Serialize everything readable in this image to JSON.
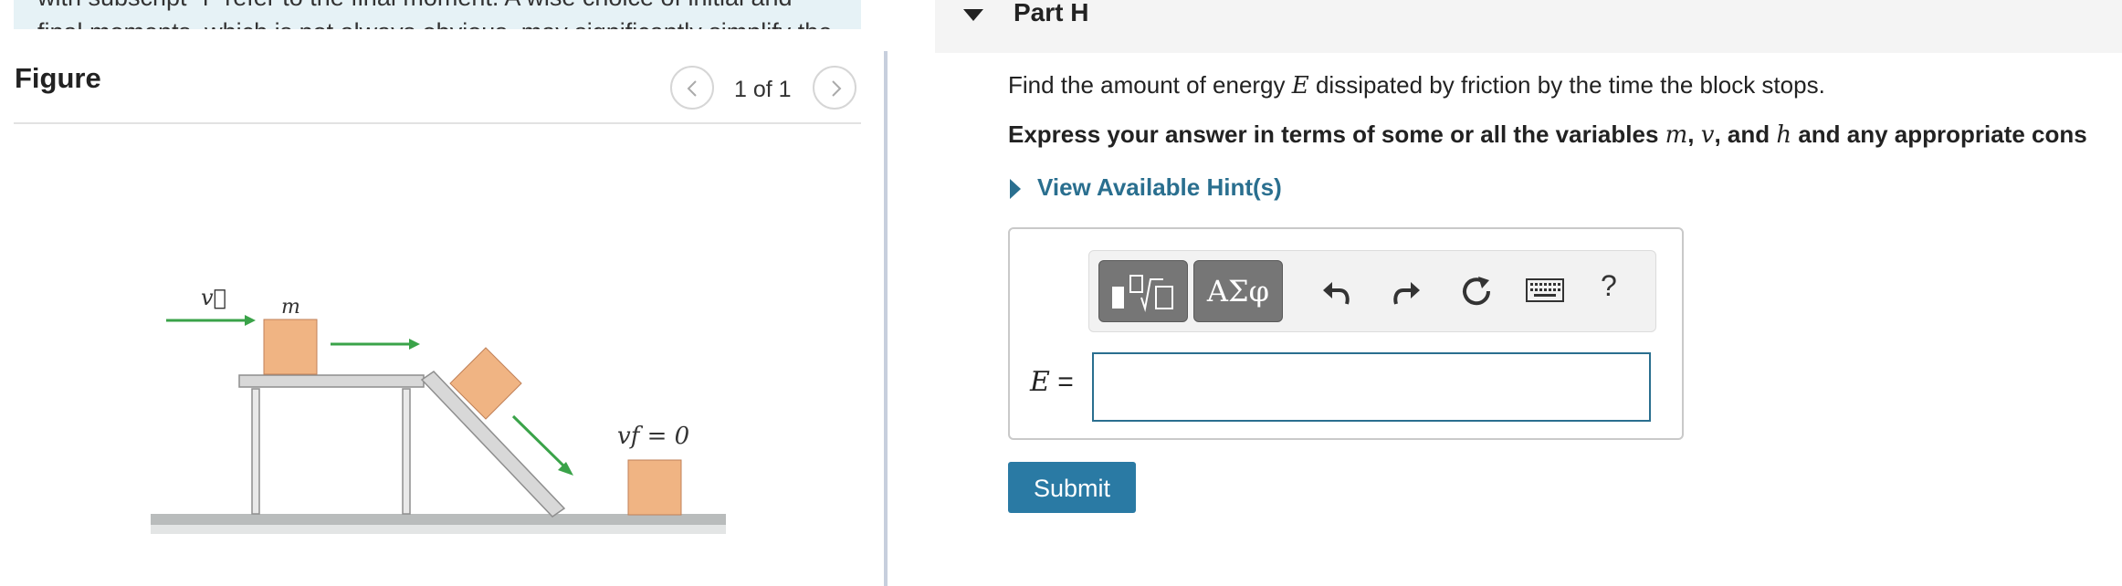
{
  "note": {
    "text": "with subscript \"f\" refer to the final moment. A wise choice of initial and final moments, which is not always obvious, may significantly simplify the"
  },
  "figure": {
    "title": "Figure",
    "pager": "1 of 1",
    "labels": {
      "velocity": "v⃗",
      "mass": "m",
      "final_velocity": "vf = 0"
    },
    "colors": {
      "block": "#f0b483",
      "arrow": "#3aa349",
      "surface": "#b9bcbc"
    }
  },
  "part": {
    "title": "Part H"
  },
  "question": {
    "text": "Find the amount of energy E dissipated by friction by the time the block stops.",
    "pre": "Find the amount of energy ",
    "var": "E",
    "post": " dissipated by friction by the time the block stops."
  },
  "instruction": {
    "pre": "Express your answer in terms of some or all the variables ",
    "v1": "m",
    "sep1": ", ",
    "v2": "v",
    "sep2": ", and ",
    "v3": "h",
    "post": " and any appropriate cons"
  },
  "hint": {
    "label": "View Available Hint(s)"
  },
  "answer": {
    "label_var": "E",
    "label_eq": " =",
    "value": "",
    "toolbar": {
      "symbols": "ΑΣφ",
      "help": "?"
    },
    "icons": [
      "template-icon",
      "undo-icon",
      "redo-icon",
      "reset-icon",
      "keyboard-icon"
    ]
  },
  "submit": {
    "label": "Submit"
  },
  "colors": {
    "accent": "#2a6f8f",
    "submit_bg": "#2a7aa4",
    "note_bg": "#e6f2f6"
  }
}
